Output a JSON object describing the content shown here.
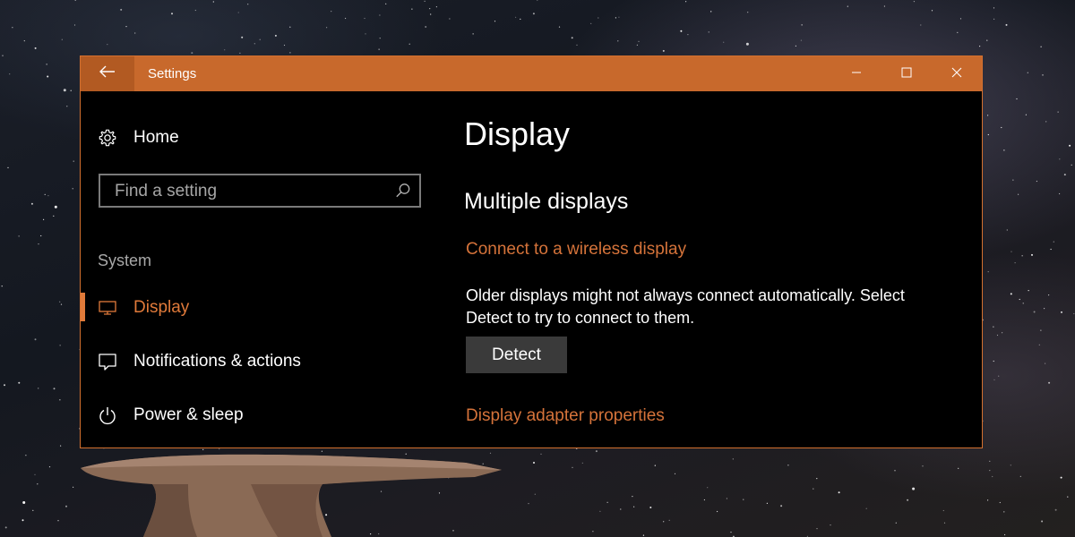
{
  "window": {
    "title": "Settings"
  },
  "sidebar": {
    "home_label": "Home",
    "search_placeholder": "Find a setting",
    "section_label": "System",
    "items": [
      {
        "label": "Display",
        "icon": "monitor-icon",
        "active": true
      },
      {
        "label": "Notifications & actions",
        "icon": "message-icon",
        "active": false
      },
      {
        "label": "Power & sleep",
        "icon": "power-icon",
        "active": false
      }
    ]
  },
  "main": {
    "title": "Display",
    "section_title": "Multiple displays",
    "wireless_link": "Connect to a wireless display",
    "description": "Older displays might not always connect automatically. Select Detect to try to connect to them.",
    "detect_button": "Detect",
    "adapter_link": "Display adapter properties"
  },
  "colors": {
    "accent": "#c8692c",
    "link": "#d5733a",
    "window_bg": "#000000"
  }
}
